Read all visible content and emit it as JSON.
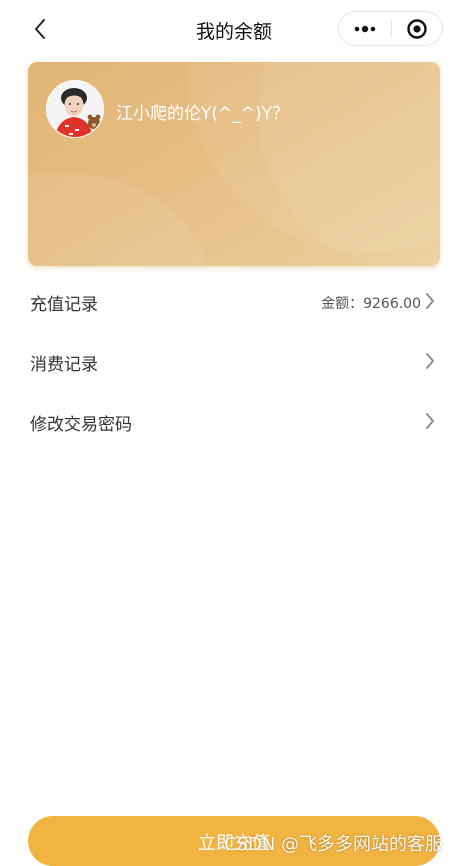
{
  "nav": {
    "title": "我的余额",
    "back_icon": "chevron-left-icon",
    "more_icon": "more-dots-icon",
    "close_icon": "target-close-icon"
  },
  "profile": {
    "username": "江小爬的伦Y(^_^)Y？",
    "avatar_icon": "avatar"
  },
  "menu": {
    "items": [
      {
        "label": "充值记录",
        "value": "金额：9266.00"
      },
      {
        "label": "消费记录",
        "value": ""
      },
      {
        "label": "修改交易密码",
        "value": ""
      }
    ]
  },
  "footer": {
    "recharge_label": "立即充值",
    "watermark": "CSDN @飞多多网站的客服"
  },
  "colors": {
    "card_gradient_start": "#e2b574",
    "card_gradient_end": "#eccf9c",
    "button": "#f2b440",
    "text_primary": "#333333"
  }
}
